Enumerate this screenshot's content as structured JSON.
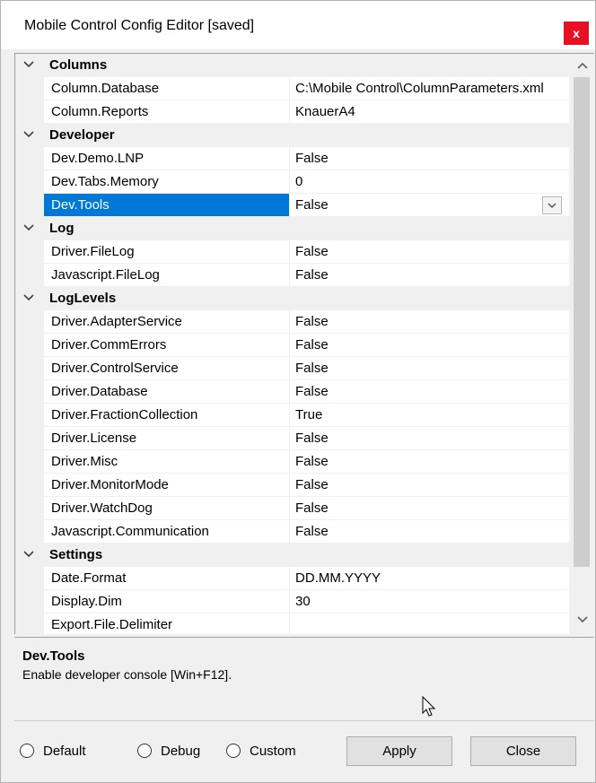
{
  "window": {
    "title": "Mobile Control Config Editor [saved]",
    "close_label": "x"
  },
  "categories": [
    {
      "label": "Columns",
      "props": [
        {
          "name": "Column.Database",
          "value": "C:\\Mobile Control\\ColumnParameters.xml"
        },
        {
          "name": "Column.Reports",
          "value": "KnauerA4"
        }
      ]
    },
    {
      "label": "Developer",
      "props": [
        {
          "name": "Dev.Demo.LNP",
          "value": "False"
        },
        {
          "name": "Dev.Tabs.Memory",
          "value": "0"
        },
        {
          "name": "Dev.Tools",
          "value": "False",
          "selected": true
        }
      ]
    },
    {
      "label": "Log",
      "props": [
        {
          "name": "Driver.FileLog",
          "value": "False"
        },
        {
          "name": "Javascript.FileLog",
          "value": "False"
        }
      ]
    },
    {
      "label": "LogLevels",
      "props": [
        {
          "name": "Driver.AdapterService",
          "value": "False"
        },
        {
          "name": "Driver.CommErrors",
          "value": "False"
        },
        {
          "name": "Driver.ControlService",
          "value": "False"
        },
        {
          "name": "Driver.Database",
          "value": "False"
        },
        {
          "name": "Driver.FractionCollection",
          "value": "True"
        },
        {
          "name": "Driver.License",
          "value": "False"
        },
        {
          "name": "Driver.Misc",
          "value": "False"
        },
        {
          "name": "Driver.MonitorMode",
          "value": "False"
        },
        {
          "name": "Driver.WatchDog",
          "value": "False"
        },
        {
          "name": "Javascript.Communication",
          "value": "False"
        }
      ]
    },
    {
      "label": "Settings",
      "props": [
        {
          "name": "Date.Format",
          "value": "DD.MM.YYYY"
        },
        {
          "name": "Display.Dim",
          "value": "30"
        },
        {
          "name": "Export.File.Delimiter",
          "value": ""
        }
      ]
    }
  ],
  "help": {
    "title": "Dev.Tools",
    "description": "Enable developer console [Win+F12]."
  },
  "footer": {
    "radio_default": "Default",
    "radio_debug": "Debug",
    "radio_custom": "Custom",
    "apply_label": "Apply",
    "close_label": "Close"
  },
  "colors": {
    "selection": "#0078d7",
    "close_button": "#e81123"
  }
}
